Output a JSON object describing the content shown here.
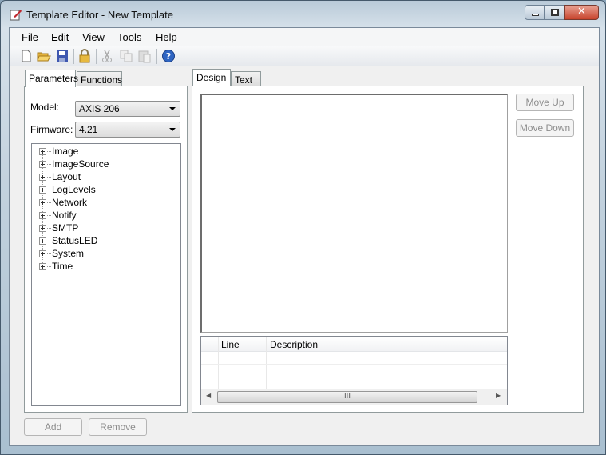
{
  "window": {
    "title": "Template Editor - New Template"
  },
  "menu": [
    "File",
    "Edit",
    "View",
    "Tools",
    "Help"
  ],
  "toolbar": [
    "new-file-icon",
    "open-folder-icon",
    "save-icon",
    "lock-icon",
    "cut-icon",
    "copy-icon",
    "paste-icon",
    "help-icon"
  ],
  "left": {
    "tabs": [
      "Parameters",
      "Functions"
    ],
    "model_label": "Model:",
    "model_value": "AXIS 206",
    "firmware_label": "Firmware:",
    "firmware_value": "4.21",
    "tree": [
      "Image",
      "ImageSource",
      "Layout",
      "LogLevels",
      "Network",
      "Notify",
      "SMTP",
      "StatusLED",
      "System",
      "Time"
    ],
    "add": "Add",
    "remove": "Remove"
  },
  "right": {
    "tabs": [
      "Design",
      "Text"
    ],
    "move_up": "Move Up",
    "move_down": "Move Down",
    "grid_columns": [
      "Line",
      "Description"
    ],
    "scroll_grip": "III"
  }
}
